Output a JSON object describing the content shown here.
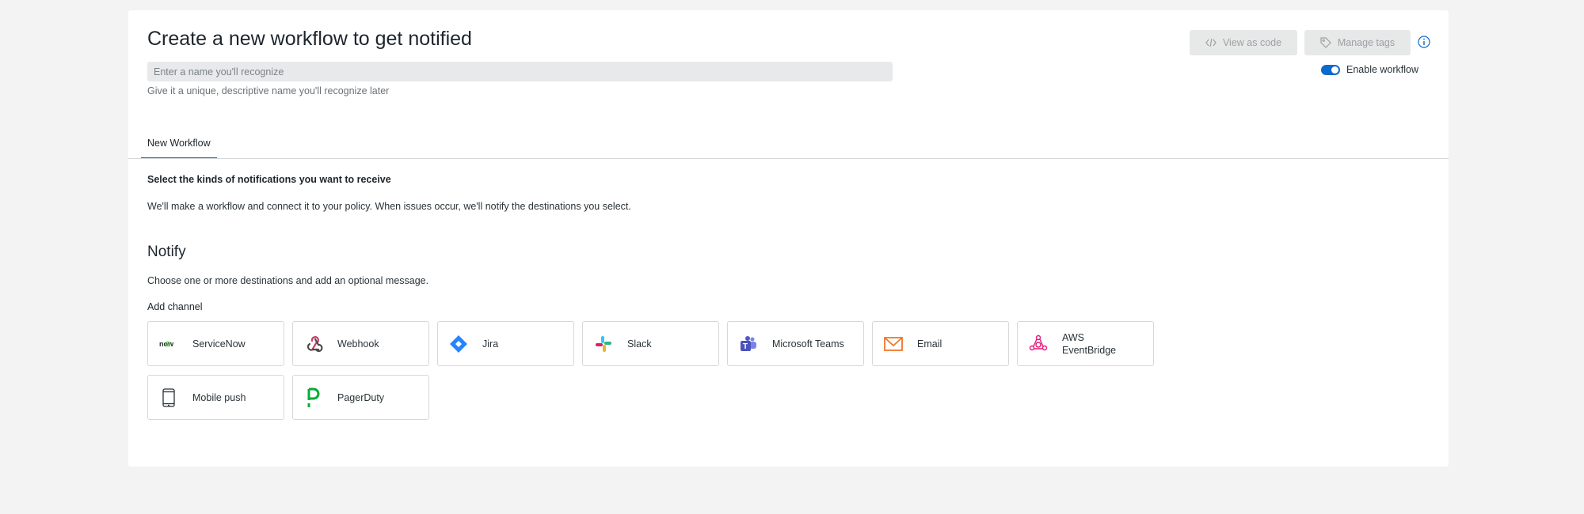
{
  "header": {
    "title": "Create a new workflow to get notified",
    "name_placeholder": "Enter a name you'll recognize",
    "name_value": "",
    "name_hint": "Give it a unique, descriptive name you'll recognize later",
    "view_code_label": "View as code",
    "manage_tags_label": "Manage tags",
    "enable_label": "Enable workflow",
    "enabled": true
  },
  "tabs": [
    {
      "label": "New Workflow",
      "active": true
    }
  ],
  "notifications": {
    "heading": "Select the kinds of notifications you want to receive",
    "description": "We'll make a workflow and connect it to your policy. When issues occur, we'll notify the destinations you select."
  },
  "notify": {
    "title": "Notify",
    "description": "Choose one or more destinations and add an optional message.",
    "add_channel_label": "Add channel",
    "channels": [
      {
        "label": "ServiceNow",
        "icon": "servicenow-icon"
      },
      {
        "label": "Webhook",
        "icon": "webhook-icon"
      },
      {
        "label": "Jira",
        "icon": "jira-icon"
      },
      {
        "label": "Slack",
        "icon": "slack-icon"
      },
      {
        "label": "Microsoft Teams",
        "icon": "microsoft-teams-icon"
      },
      {
        "label": "Email",
        "icon": "email-icon"
      },
      {
        "label": "AWS EventBridge",
        "icon": "aws-eventbridge-icon"
      },
      {
        "label": "Mobile push",
        "icon": "mobile-push-icon"
      },
      {
        "label": "PagerDuty",
        "icon": "pagerduty-icon"
      }
    ],
    "servicenow_logo_text": "now"
  },
  "colors": {
    "accent": "#0b6acb",
    "background": "#f2f3f2",
    "card": "#ffffff"
  }
}
